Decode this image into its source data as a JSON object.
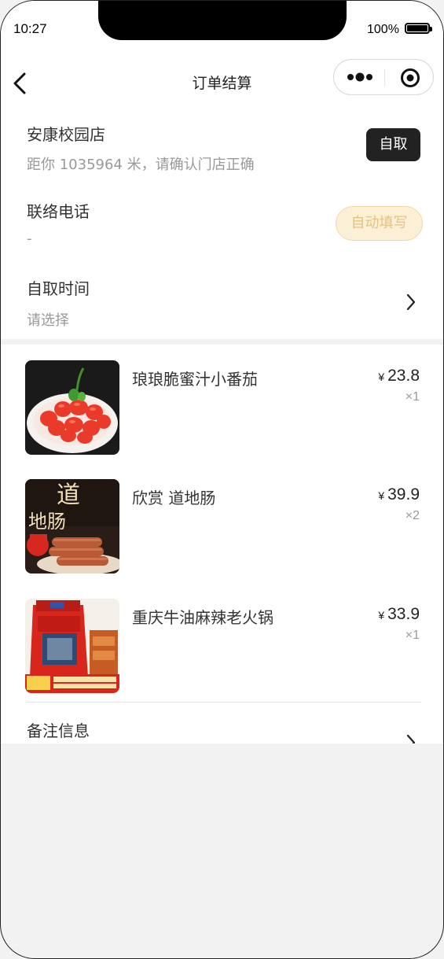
{
  "status_bar": {
    "time": "10:27",
    "battery_percent": "100%"
  },
  "nav": {
    "title": "订单结算",
    "back_icon": "chevron-left-icon",
    "more_icon": "more-dots-icon",
    "close_icon": "target-circle-icon"
  },
  "store": {
    "name": "安康校园店",
    "distance_note": "距你 1035964 米，请确认门店正确",
    "mode_tag": "自取"
  },
  "contact": {
    "label": "联络电话",
    "value": "-",
    "auto_fill_label": "自动填写"
  },
  "pickup_time": {
    "label": "自取时间",
    "placeholder": "请选择"
  },
  "products": [
    {
      "name": "琅琅脆蜜汁小番茄",
      "currency": "¥",
      "price": "23.8",
      "qty": "×1"
    },
    {
      "name": "欣赏 道地肠",
      "currency": "¥",
      "price": "39.9",
      "qty": "×2"
    },
    {
      "name": "重庆牛油麻辣老火锅",
      "currency": "¥",
      "price": "33.9",
      "qty": "×1"
    }
  ],
  "remark": {
    "label": "备注信息",
    "value": "-"
  },
  "colors": {
    "accent_gold": "#e4c283",
    "dark": "#222222",
    "background": "#f2f2f2"
  }
}
